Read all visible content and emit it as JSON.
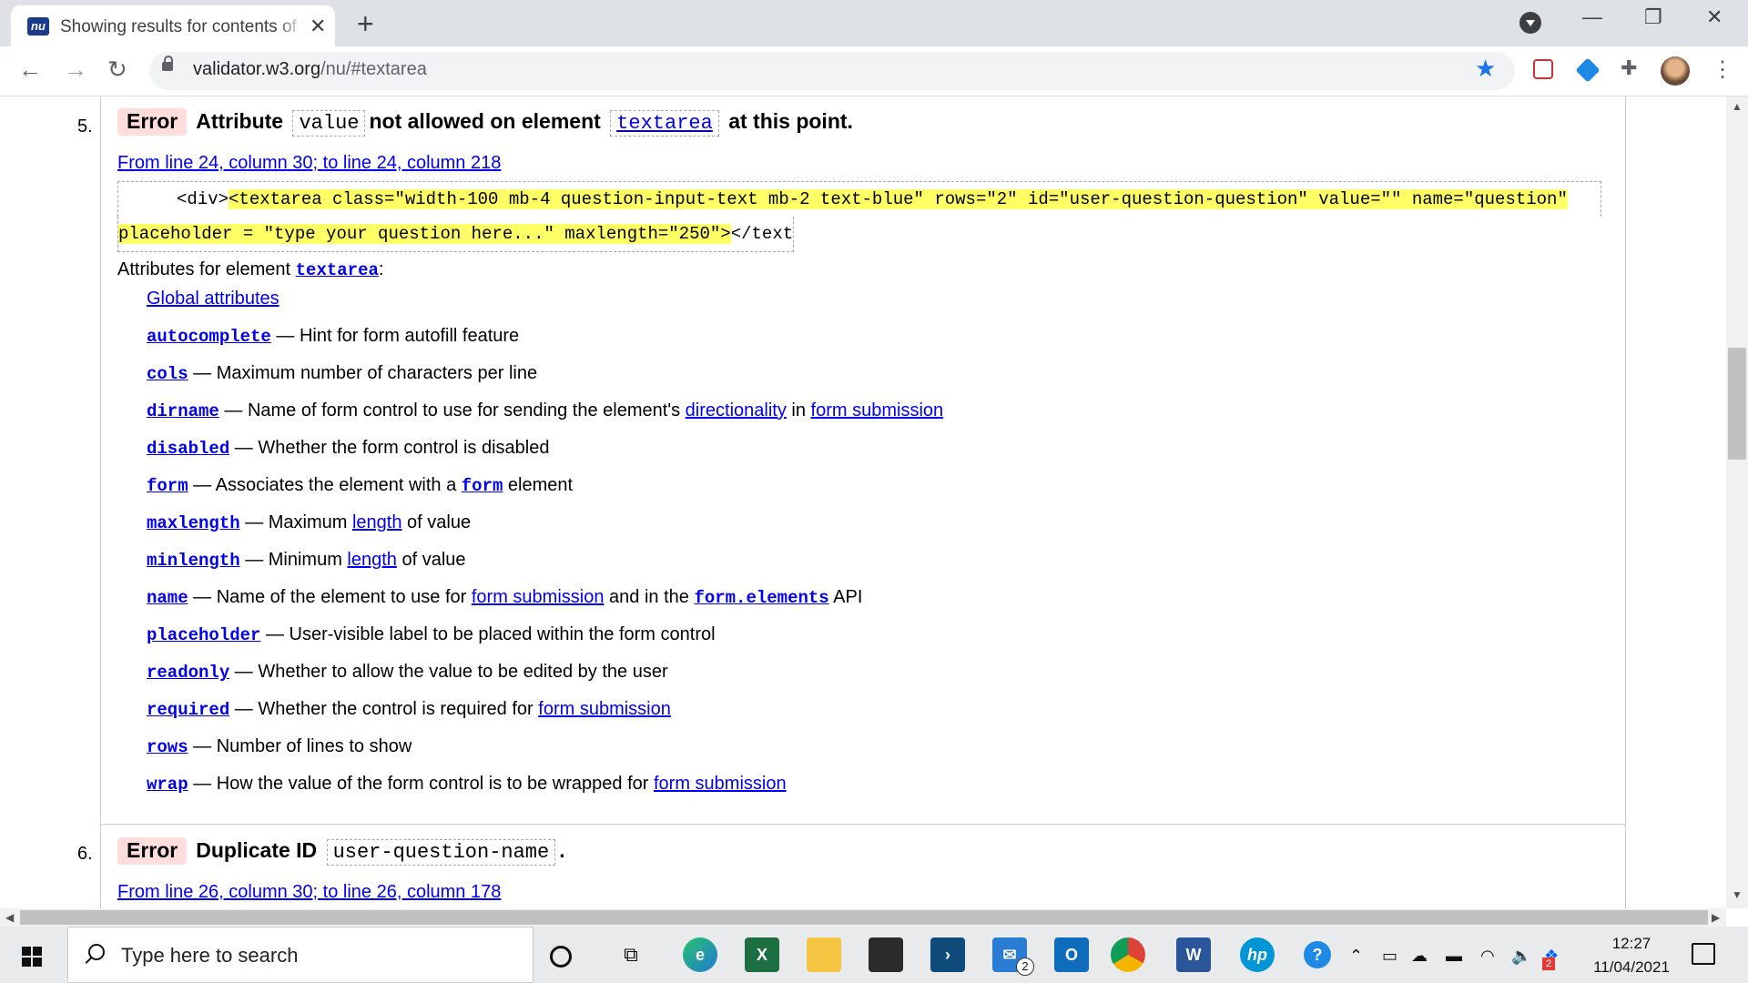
{
  "browser": {
    "tab_title": "Showing results for contents of textarea",
    "tab_favicon": "nu",
    "new_tab": "+",
    "url_host": "validator.w3.org",
    "url_path": "/nu/#textarea",
    "window_controls": {
      "minimize": "—",
      "restore": "❐",
      "close": "✕"
    }
  },
  "messages": [
    {
      "number": "5.",
      "type": "Error",
      "text_before": "Attribute",
      "code1": "value",
      "text_middle": "not allowed on element",
      "code2": "textarea",
      "text_after": "at this point.",
      "location": "From line 24, column 30; to line 24, column 218",
      "extract_pre": "<div>",
      "extract_hl_line1": "<textarea class=\"width-100 mb-4 question-input-text mb-2 text-blue\" rows=\"2\" id=\"user-question-question\" value=\"\" name=\"question\"",
      "extract_hl_line2": "placeholder = \"type your question here...\" maxlength=\"250\">",
      "extract_post": "</text",
      "attrs_title_prefix": "Attributes for element",
      "attrs_title_element": "textarea",
      "attrs_title_suffix": ":",
      "global_attributes": "Global attributes",
      "attributes": [
        {
          "name": "autocomplete",
          "parts": [
            "— Hint for form autofill feature"
          ]
        },
        {
          "name": "cols",
          "parts": [
            "— Maximum number of characters per line"
          ]
        },
        {
          "name": "dirname",
          "parts": [
            "— Name of form control to use for sending the element's ",
            "directionality",
            " in ",
            "form submission"
          ]
        },
        {
          "name": "disabled",
          "parts": [
            "— Whether the form control is disabled"
          ]
        },
        {
          "name": "form",
          "parts": [
            "— Associates the element with a ",
            "form",
            " element"
          ]
        },
        {
          "name": "maxlength",
          "parts": [
            "— Maximum ",
            "length",
            " of value"
          ]
        },
        {
          "name": "minlength",
          "parts": [
            "— Minimum ",
            "length",
            " of value"
          ]
        },
        {
          "name": "name",
          "parts": [
            "— Name of the element to use for ",
            "form submission",
            " and in the ",
            "form.elements",
            " API"
          ]
        },
        {
          "name": "placeholder",
          "parts": [
            "— User-visible label to be placed within the form control"
          ]
        },
        {
          "name": "readonly",
          "parts": [
            "— Whether to allow the value to be edited by the user"
          ]
        },
        {
          "name": "required",
          "parts": [
            "— Whether the control is required for ",
            "form submission"
          ]
        },
        {
          "name": "rows",
          "parts": [
            "— Number of lines to show"
          ]
        },
        {
          "name": "wrap",
          "parts": [
            "— How the value of the form control is to be wrapped for ",
            "form submission"
          ]
        }
      ]
    },
    {
      "number": "6.",
      "type": "Error",
      "text_before": "Duplicate ID",
      "code1": "user-question-name",
      "text_after": ".",
      "location": "From line 26, column 30; to line 26, column 178"
    }
  ],
  "taskbar": {
    "search_placeholder": "Type here to search",
    "mail_badge": "2",
    "dropbox_badge": "2",
    "time": "12:27",
    "date": "11/04/2021"
  },
  "colors": {
    "link": "#0000ee",
    "error_badge": "#ffdddd",
    "highlight": "#ffff66",
    "tab_strip": "#dee1e6"
  }
}
